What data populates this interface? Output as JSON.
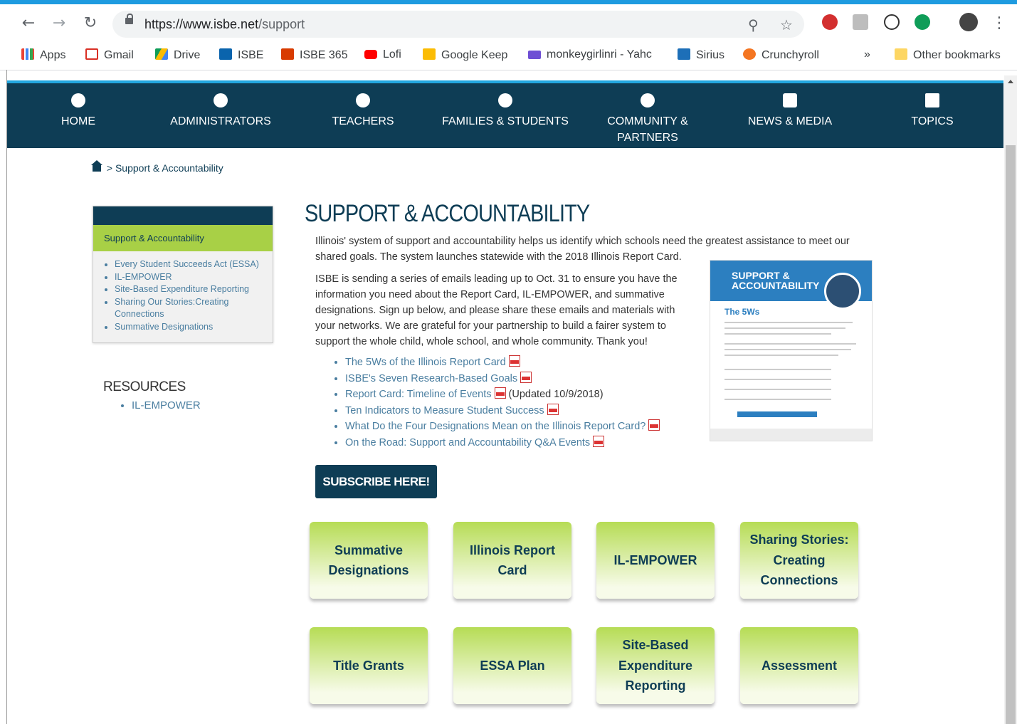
{
  "browser": {
    "url_host": "https://www.isbe.net",
    "url_path": "/support",
    "bookmarks": [
      "Apps",
      "Gmail",
      "Drive",
      "ISBE",
      "ISBE 365",
      "Lofi",
      "Google Keep",
      "monkeygirlinri - Yahc",
      "Sirius",
      "Crunchyroll"
    ],
    "bookmarks_more": "»",
    "other_bookmarks": "Other bookmarks"
  },
  "nav": [
    "HOME",
    "ADMINISTRATORS",
    "TEACHERS",
    "FAMILIES & STUDENTS",
    "COMMUNITY & PARTNERS",
    "NEWS & MEDIA",
    "TOPICS"
  ],
  "breadcrumb": {
    "sep": ">",
    "current": "Support & Accountability"
  },
  "sidebar": {
    "active": "Support & Accountability",
    "items": [
      "Every Student Succeeds Act (ESSA)",
      "IL-EMPOWER",
      "Site-Based Expenditure Reporting",
      "Sharing Our Stories:Creating Connections",
      "Summative Designations"
    ]
  },
  "resources": {
    "title": "RESOURCES",
    "items": [
      "IL-EMPOWER"
    ]
  },
  "main": {
    "title": "SUPPORT & ACCOUNTABILITY",
    "intro": "Illinois' system of support and accountability helps us identify which schools need the greatest assistance to meet our shared goals. The system launches statewide with the 2018 Illinois Report Card.",
    "intro2": "ISBE is sending a series of emails leading up to Oct. 31 to ensure you have the information you need about the Report Card, IL-EMPOWER, and summative designations. Sign up below, and please share these emails and materials with your networks. We are grateful for your partnership to build a fairer system to support the whole child, whole school, and whole community. Thank you!",
    "links": [
      "The 5Ws of the Illinois Report Card",
      "ISBE's Seven Research-Based Goals",
      "Report Card: Timeline of Events",
      "Ten Indicators to Measure Student Success",
      "What Do the Four Designations Mean on the Illinois Report Card?",
      "On the Road: Support and Accountability Q&A Events"
    ],
    "updated_note": "(Updated 10/9/2018)",
    "flyer": {
      "heading_line1": "SUPPORT &",
      "heading_line2": "ACCOUNTABILITY",
      "subheading": "The 5Ws"
    },
    "subscribe": "SUBSCRIBE HERE!",
    "tiles": [
      "Summative Designations",
      "Illinois Report Card",
      "IL-EMPOWER",
      "Sharing Stories: Creating Connections",
      "Title Grants",
      "ESSA Plan",
      "Site-Based Expenditure Reporting",
      "Assessment"
    ]
  },
  "colors": {
    "nav_bg": "#0e3d55",
    "accent_green": "#a8d046",
    "link": "#4a7ea0",
    "top_strip": "#1e9be0"
  }
}
